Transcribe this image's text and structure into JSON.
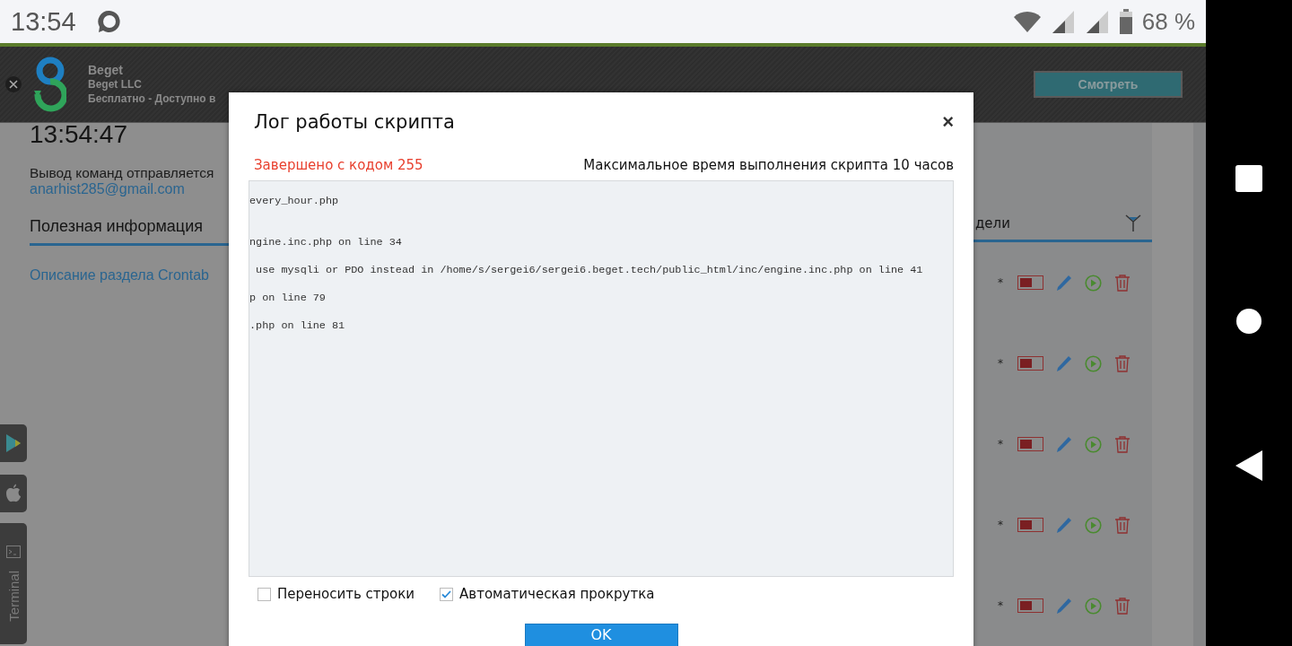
{
  "status_bar": {
    "time": "13:54",
    "battery": "68 %"
  },
  "ad_banner": {
    "title": "Beget",
    "publisher": "Beget LLC",
    "subtitle": "Бесплатно - Доступно в",
    "button": "Смотреть"
  },
  "page": {
    "time": "13:54:47",
    "output_note": "Вывод команд отправляется",
    "email": "anarhist285@gmail.com",
    "section_title": "Полезная информация",
    "link": "Описание раздела Crontab",
    "table_header": "дели",
    "rows": [
      {
        "schedule": "*",
        "on": false
      },
      {
        "schedule": "*",
        "on": false
      },
      {
        "schedule": "*",
        "on": false
      },
      {
        "schedule": "*",
        "on": false
      },
      {
        "schedule": "*",
        "on": false
      }
    ],
    "side_buttons": [
      {
        "kind": "google_play"
      },
      {
        "kind": "apple"
      },
      {
        "kind": "terminal",
        "label": "Terminal"
      }
    ]
  },
  "modal": {
    "title": "Лог работы скрипта",
    "close": "×",
    "exit_status": "Завершено с кодом 255",
    "time_limit": "Максимальное время выполнения скрипта 10 часов",
    "log_lines": [
      "every_hour.php",
      "ngine.inc.php on line 34",
      " use mysqli or PDO instead in /home/s/sergei6/sergei6.beget.tech/public_html/inc/engine.inc.php on line 41",
      "p on line 79",
      ".php on line 81"
    ],
    "options": [
      {
        "label": "Переносить строки",
        "checked": false
      },
      {
        "label": "Автоматическая прокрутка",
        "checked": true
      }
    ],
    "ok_button": "OK"
  }
}
